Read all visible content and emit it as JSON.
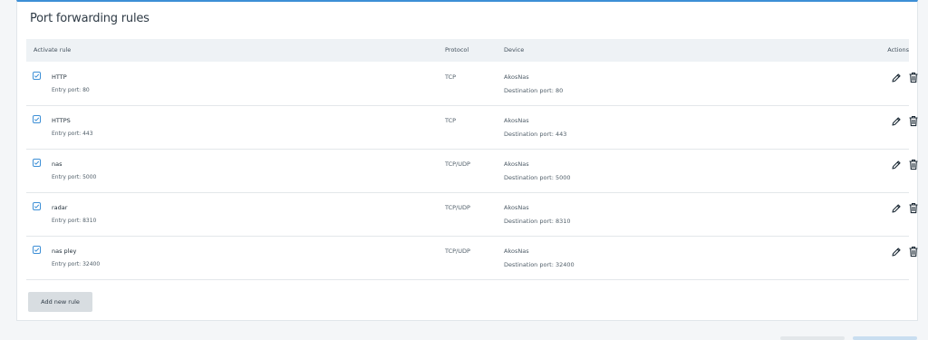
{
  "section": {
    "title": "Port forwarding rules"
  },
  "table": {
    "headers": {
      "activate": "Activate rule",
      "protocol": "Protocol",
      "device": "Device",
      "actions": "Actions"
    },
    "rows": [
      {
        "checked": true,
        "name": "HTTP",
        "entry": "Entry port: 80",
        "protocol": "TCP",
        "device": "AkosNas",
        "dest": "Destination port: 80"
      },
      {
        "checked": true,
        "name": "HTTPS",
        "entry": "Entry port: 443",
        "protocol": "TCP",
        "device": "AkosNas",
        "dest": "Destination port: 443"
      },
      {
        "checked": true,
        "name": "nas",
        "entry": "Entry port: 5000",
        "protocol": "TCP/UDP",
        "device": "AkosNas",
        "dest": "Destination port: 5000"
      },
      {
        "checked": true,
        "name": "radar",
        "entry": "Entry port: 8310",
        "protocol": "TCP/UDP",
        "device": "AkosNas",
        "dest": "Destination port: 8310"
      },
      {
        "checked": true,
        "name": "nas pley",
        "entry": "Entry port: 32400",
        "protocol": "TCP/UDP",
        "device": "AkosNas",
        "dest": "Destination port: 32400"
      }
    ]
  },
  "buttons": {
    "add_rule": "Add new rule"
  },
  "icons": {
    "edit": "pencil-icon",
    "delete": "trash-icon",
    "checkbox": "checkbox-checked-icon"
  },
  "colors": {
    "accent": "#3d8fd6",
    "header_bg": "#eef2f5",
    "button_bg": "#d8dde1"
  }
}
